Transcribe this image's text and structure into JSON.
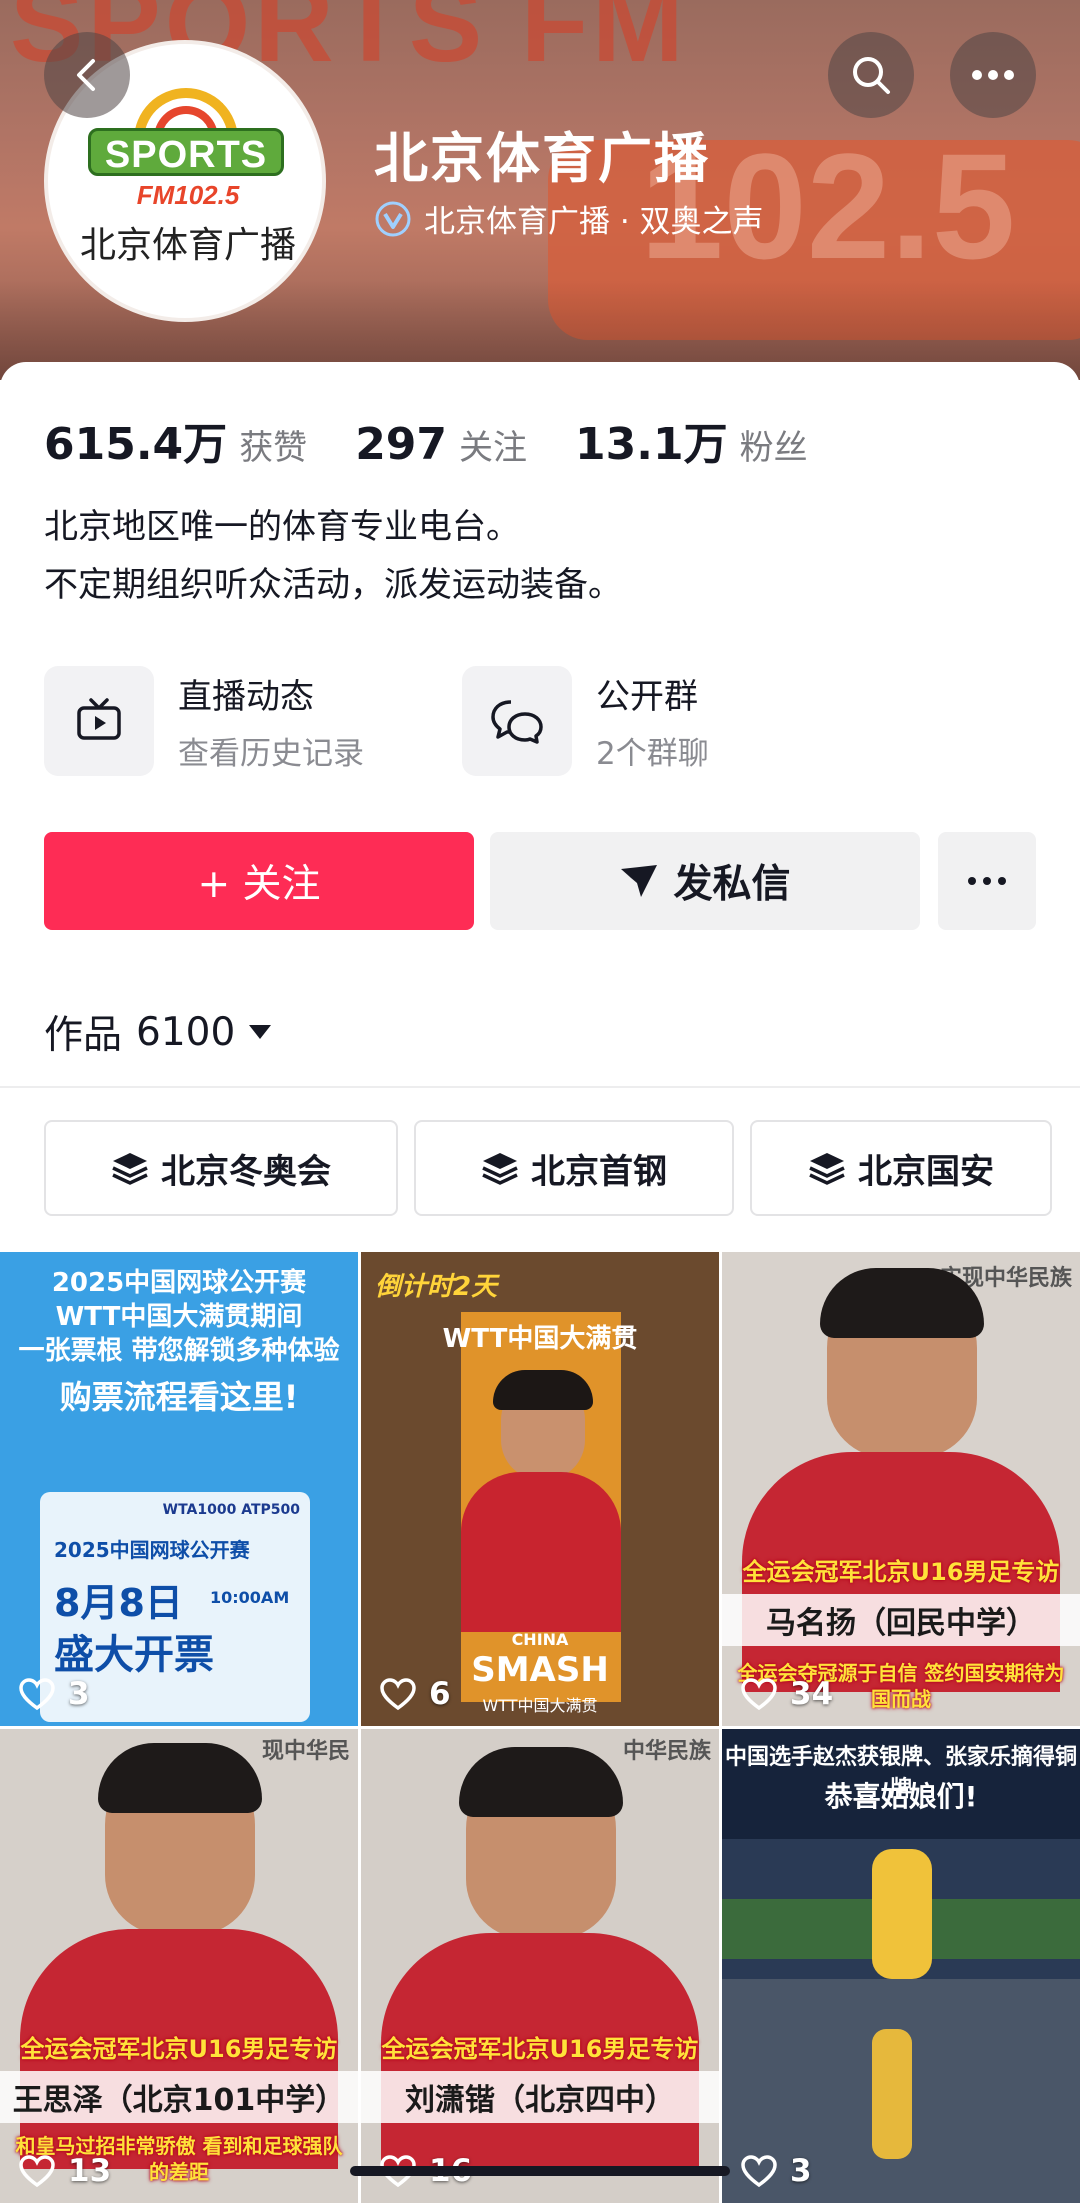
{
  "header": {
    "wall_text": "SPORTS FM",
    "freq_text": "102.5",
    "profile_name": "北京体育广播",
    "verify_text": "北京体育广播 · 双奥之声",
    "logo": {
      "sports": "SPORTS",
      "fm": "FM102.5",
      "cn": "北京体育广播"
    }
  },
  "stats": [
    {
      "value": "615.4万",
      "label": "获赞"
    },
    {
      "value": "297",
      "label": "关注"
    },
    {
      "value": "13.1万",
      "label": "粉丝"
    }
  ],
  "bio": {
    "line1": "北京地区唯一的体育专业电台。",
    "line2": "不定期组织听众活动，派发运动装备。"
  },
  "features": [
    {
      "title": "直播动态",
      "subtitle": "查看历史记录",
      "icon": "tv-icon"
    },
    {
      "title": "公开群",
      "subtitle": "2个群聊",
      "icon": "chat-bubbles-icon"
    }
  ],
  "actions": {
    "follow_label": "+ 关注",
    "message_label": "发私信"
  },
  "works": {
    "label": "作品",
    "count": "6100"
  },
  "collections": [
    "北京冬奥会",
    "北京首钢",
    "北京国安"
  ],
  "videos": [
    {
      "likes": "3",
      "top_lines": [
        "2025中国网球公开赛",
        "WTT中国大满贯期间",
        "一张票根 带您解锁多种体验",
        "购票流程看这里!"
      ],
      "panel_lines": [
        "2025中国网球公开赛",
        "8月8日",
        "10:00AM",
        "盛大开票"
      ],
      "badge": "WTA1000 ATP500"
    },
    {
      "likes": "6",
      "top_lines": [
        "倒计时2天",
        "WTT中国大满贯"
      ],
      "bottom_lines": [
        "CHINA",
        "SMASH",
        "WTT中国大满贯"
      ]
    },
    {
      "likes": "34",
      "caption": "全运会冠军北京U16男足专访",
      "name": "马名扬（回民中学）",
      "sub": "全运会夺冠源于自信 签约国安期待为国而战",
      "corner": "实现中华民族"
    },
    {
      "likes": "13",
      "caption": "全运会冠军北京U16男足专访",
      "name": "王思泽（北京101中学）",
      "sub": "和皇马过招非常骄傲 看到和足球强队的差距",
      "corner": "现中华民"
    },
    {
      "likes": "16",
      "caption": "全运会冠军北京U16男足专访",
      "name": "刘潇锴（北京四中）",
      "sub": "",
      "corner": "中华民族"
    },
    {
      "likes": "3",
      "top_lines": [
        "中国选手赵杰获银牌、张家乐摘得铜牌",
        "恭喜姑娘们!"
      ]
    }
  ]
}
